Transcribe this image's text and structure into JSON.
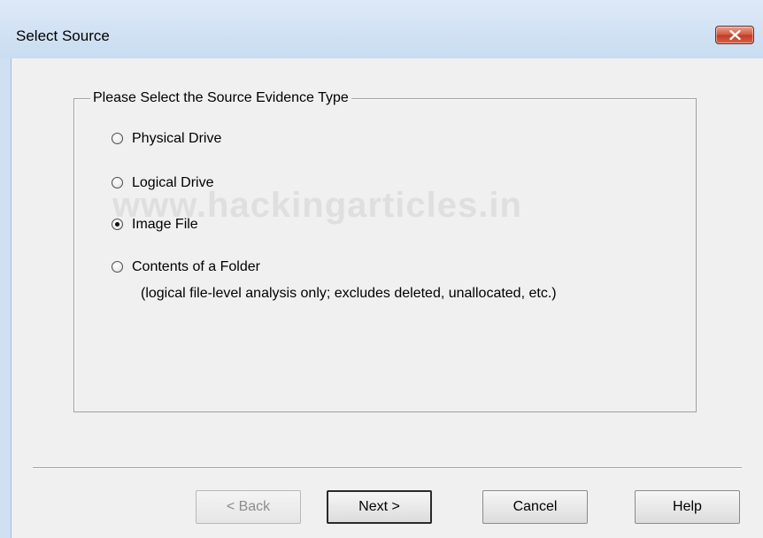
{
  "window": {
    "title": "Select Source",
    "close_icon": "close-x-icon",
    "accent_close_color": "#c53a22"
  },
  "group": {
    "legend": "Please Select the Source Evidence Type",
    "selected_option": "Image File",
    "options": [
      {
        "label": "Physical Drive",
        "selected": false
      },
      {
        "label": "Logical Drive",
        "selected": false
      },
      {
        "label": "Image File",
        "selected": true
      },
      {
        "label": "Contents of a Folder",
        "selected": false
      }
    ],
    "folder_note": "(logical file-level analysis only; excludes deleted, unallocated, etc.)"
  },
  "watermark": "www.hackingarticles.in",
  "buttons": {
    "back": "< Back",
    "next": "Next >",
    "cancel": "Cancel",
    "help": "Help"
  }
}
